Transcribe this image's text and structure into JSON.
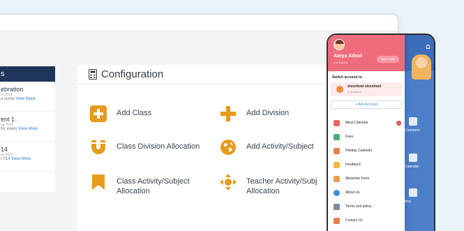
{
  "notices": {
    "header": "s",
    "items": [
      {
        "title": "ebration",
        "date": "ul 2018",
        "desc": "o come",
        "link": "View More"
      },
      {
        "title": "ent 1",
        "date": "ug 2018",
        "desc": "for exam",
        "link": "View More"
      },
      {
        "title": "14",
        "date": "ec 2019",
        "desc": "t 014",
        "link": "View More"
      }
    ]
  },
  "config": {
    "title": "Configuration",
    "items": [
      {
        "label": "Add Class",
        "icon": "plus-box-icon"
      },
      {
        "label": "Add Division",
        "icon": "plus-icon"
      },
      {
        "label": "Class Division Allocation",
        "icon": "magnet-icon"
      },
      {
        "label": "Add Activity/Subject",
        "icon": "globe-icon"
      },
      {
        "label": "Class Activity/Subject Allocation",
        "icon": "bookmark-icon"
      },
      {
        "label": "Teacher Activity/Subj Allocation",
        "icon": "move-arrows-icon"
      }
    ]
  },
  "phone": {
    "user_name": "Aarya Adsul",
    "user_class": "A (Division)",
    "view_profile": "View Profile",
    "switch_label": "Switch account to",
    "account_name": "stsschool stsschool",
    "account_class": "A (Division)",
    "add_account": "+  Add Account",
    "menu": [
      {
        "label": "Meal Calendar",
        "badge": "4",
        "color": "#e56a6a"
      },
      {
        "label": "Fees",
        "color": "#4caf7a"
      },
      {
        "label": "Holiday Calender",
        "color": "#e0824a"
      },
      {
        "label": "Feedback",
        "color": "#f0b93b"
      },
      {
        "label": "Absentee Form",
        "color": "#e6a04a"
      },
      {
        "label": "About Us",
        "color": "#3b8fdc"
      },
      {
        "label": "Terms and policy",
        "color": "#7a8a99"
      },
      {
        "label": "Contact Us",
        "color": "#e0824a"
      }
    ],
    "tiles": [
      "Comment",
      "Calendar",
      "llery"
    ]
  },
  "colors": {
    "accent": "#e89a1b",
    "navy": "#1f3559",
    "pink": "#f06c7c"
  }
}
